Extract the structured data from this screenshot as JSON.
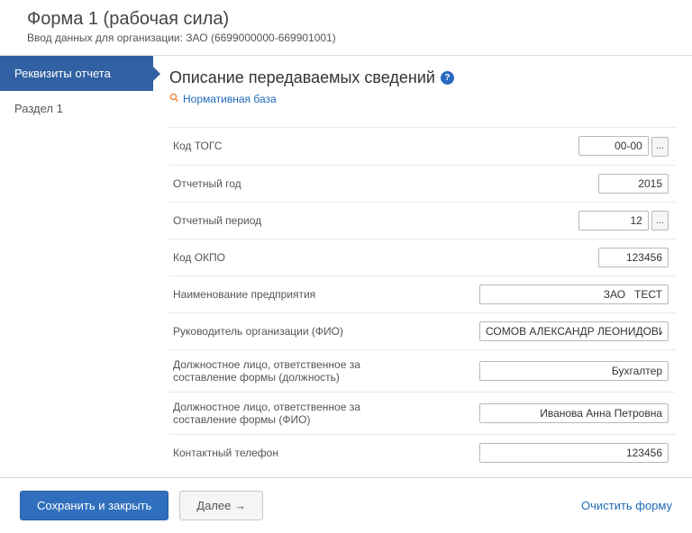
{
  "header": {
    "title": "Форма 1 (рабочая сила)",
    "subtitle": "Ввод данных для организации: ЗАО  (6699000000-669901001)"
  },
  "sidebar": {
    "items": [
      {
        "label": "Реквизиты отчета"
      },
      {
        "label": "Раздел 1"
      }
    ]
  },
  "content": {
    "section_title": "Описание передаваемых сведений",
    "help_icon": "?",
    "normative_link": "Нормативная база"
  },
  "fields": [
    {
      "label": "Код ТОГС",
      "value": "00-00",
      "width": "short",
      "lookup": true
    },
    {
      "label": "Отчетный год",
      "value": "2015",
      "width": "short",
      "lookup": false
    },
    {
      "label": "Отчетный период",
      "value": "12",
      "width": "short",
      "lookup": true
    },
    {
      "label": "Код ОКПО",
      "value": "123456",
      "width": "short",
      "lookup": false
    },
    {
      "label": "Наименование предприятия",
      "value": "ЗАО   ТЕСТ",
      "width": "long",
      "lookup": false
    },
    {
      "label": "Руководитель организации (ФИО)",
      "value": "СОМОВ АЛЕКСАНДР ЛЕОНИДОВИЧ",
      "width": "long",
      "lookup": false
    },
    {
      "label": "Должностное лицо, ответственное за составление формы (должность)",
      "value": "Бухгалтер",
      "width": "long",
      "lookup": false
    },
    {
      "label": "Должностное лицо, ответственное за составление формы (ФИО)",
      "value": "Иванова Анна Петровна",
      "width": "long",
      "lookup": false
    },
    {
      "label": "Контактный телефон",
      "value": "123456",
      "width": "long",
      "lookup": false
    }
  ],
  "footer": {
    "save_close": "Сохранить и закрыть",
    "next": "Далее →",
    "clear": "Очистить форму"
  },
  "lookup_btn_label": "..."
}
